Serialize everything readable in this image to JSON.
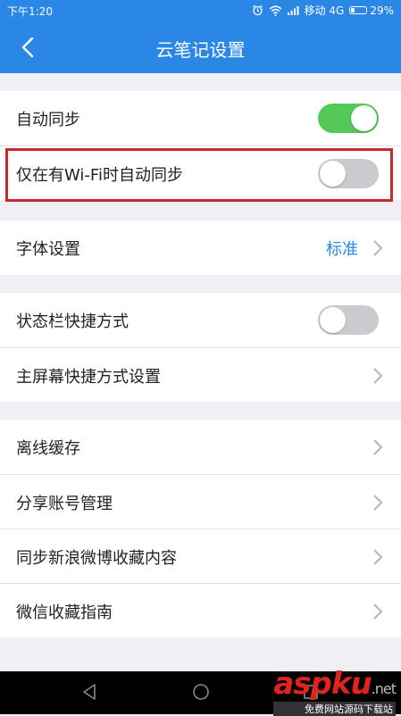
{
  "status_bar": {
    "time": "下午1:20",
    "carrier": "移动 4G",
    "battery": "29%",
    "battery_level": 0.29,
    "icons": [
      "alarm-icon",
      "wifi-icon",
      "signal-icon",
      "battery-icon"
    ]
  },
  "header": {
    "title": "云笔记设置",
    "back_icon": "back-arrow-icon"
  },
  "groups": [
    {
      "rows": [
        {
          "label": "自动同步",
          "control": "toggle",
          "on": true
        },
        {
          "label": "仅在有Wi-Fi时自动同步",
          "control": "toggle",
          "on": false,
          "highlighted": true
        }
      ]
    },
    {
      "rows": [
        {
          "label": "字体设置",
          "value": "标准",
          "control": "chevron"
        }
      ]
    },
    {
      "rows": [
        {
          "label": "状态栏快捷方式",
          "control": "toggle",
          "on": false
        },
        {
          "label": "主屏幕快捷方式设置",
          "control": "chevron"
        }
      ]
    },
    {
      "rows": [
        {
          "label": "离线缓存",
          "control": "chevron"
        },
        {
          "label": "分享账号管理",
          "control": "chevron"
        },
        {
          "label": "同步新浪微博收藏内容",
          "control": "chevron"
        },
        {
          "label": "微信收藏指南",
          "control": "chevron"
        }
      ]
    }
  ],
  "nav_bar": {
    "buttons": [
      "back-triangle-icon",
      "home-circle-icon",
      "recents-square-icon"
    ]
  },
  "watermark": {
    "brand": "aspku",
    "tld": ".net",
    "tagline": "免费网站源码下载站"
  },
  "colors": {
    "primary": "#2b87e6",
    "toggle_on": "#55c85a",
    "toggle_off": "#c9cbcf",
    "highlight_border": "#c8282d",
    "background": "#efeff4"
  }
}
